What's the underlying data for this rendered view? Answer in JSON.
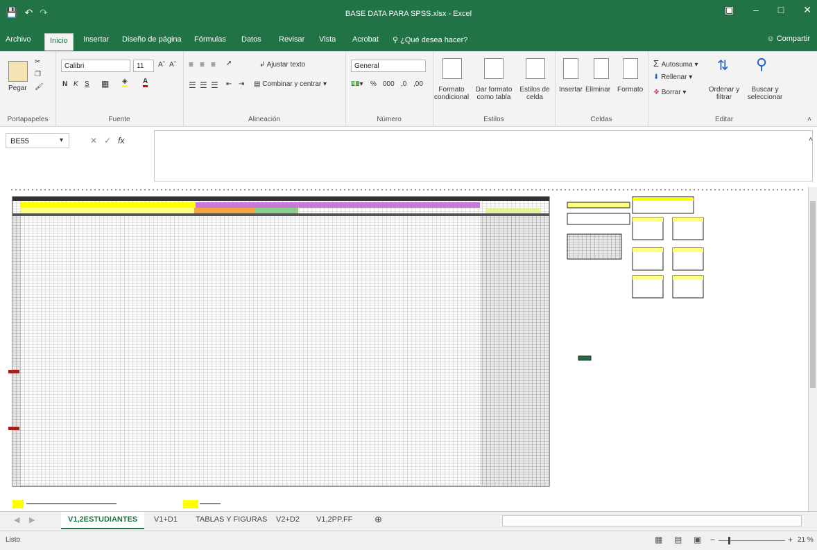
{
  "window": {
    "title": "BASE DATA PARA SPSS.xlsx - Excel"
  },
  "ribbon_tabs": [
    "Archivo",
    "Inicio",
    "Insertar",
    "Diseño de página",
    "Fórmulas",
    "Datos",
    "Revisar",
    "Vista",
    "Acrobat"
  ],
  "tell_me": "¿Qué desea hacer?",
  "share": "Compartir",
  "clipboard": {
    "paste": "Pegar",
    "label": "Portapapeles"
  },
  "font": {
    "name": "Calibri",
    "size": "11",
    "bold": "N",
    "italic": "K",
    "underline": "S",
    "label": "Fuente"
  },
  "alignment": {
    "wrap": "Ajustar texto",
    "merge": "Combinar y centrar",
    "label": "Alineación"
  },
  "number": {
    "format": "General",
    "label": "Número"
  },
  "styles": {
    "conditional": "Formato condicional",
    "as_table": "Dar formato como tabla",
    "cell_styles": "Estilos de celda",
    "label": "Estilos"
  },
  "cells": {
    "insert": "Insertar",
    "delete": "Eliminar",
    "format": "Formato",
    "label": "Celdas"
  },
  "editing": {
    "autosum": "Autosuma",
    "fill": "Rellenar",
    "clear": "Borrar",
    "sort": "Ordenar y filtrar",
    "find": "Buscar y seleccionar",
    "label": "Editar"
  },
  "namebox": "BE55",
  "formula": "",
  "sheet_tabs": [
    "V1,2ESTUDIANTES",
    "V1+D1",
    "TABLAS Y FIGURAS",
    "V2+D2",
    "V1,2PP.FF"
  ],
  "status": {
    "ready": "Listo",
    "zoom": "21 %"
  },
  "colors": {
    "excel_green": "#217346",
    "ribbon_bg": "#f3f3f3"
  }
}
